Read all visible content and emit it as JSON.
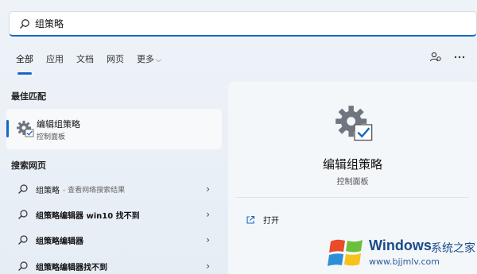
{
  "search": {
    "value": "组策略"
  },
  "tabs": [
    {
      "label": "全部"
    },
    {
      "label": "应用"
    },
    {
      "label": "文档"
    },
    {
      "label": "网页"
    },
    {
      "label": "更多"
    }
  ],
  "sections": {
    "best_match": "最佳匹配",
    "search_web": "搜索网页"
  },
  "best_match": {
    "title": "编辑组策略",
    "subtitle": "控制面板"
  },
  "web_results": [
    {
      "main": "组策略",
      "hint": "- 查看网络搜索结果",
      "bold": false
    },
    {
      "main": "组策略编辑器 win10 找不到",
      "hint": "",
      "bold": true
    },
    {
      "main": "组策略编辑器",
      "hint": "",
      "bold": true
    },
    {
      "main": "组策略编辑器找不到",
      "hint": "",
      "bold": true
    }
  ],
  "panel": {
    "title": "编辑组策略",
    "subtitle": "控制面板",
    "open_label": "打开"
  },
  "watermark": {
    "brand": "Windows",
    "brand_cn": "系统之家",
    "url": "www.bjjmlv.com"
  },
  "colors": {
    "accent": "#1667c7"
  }
}
